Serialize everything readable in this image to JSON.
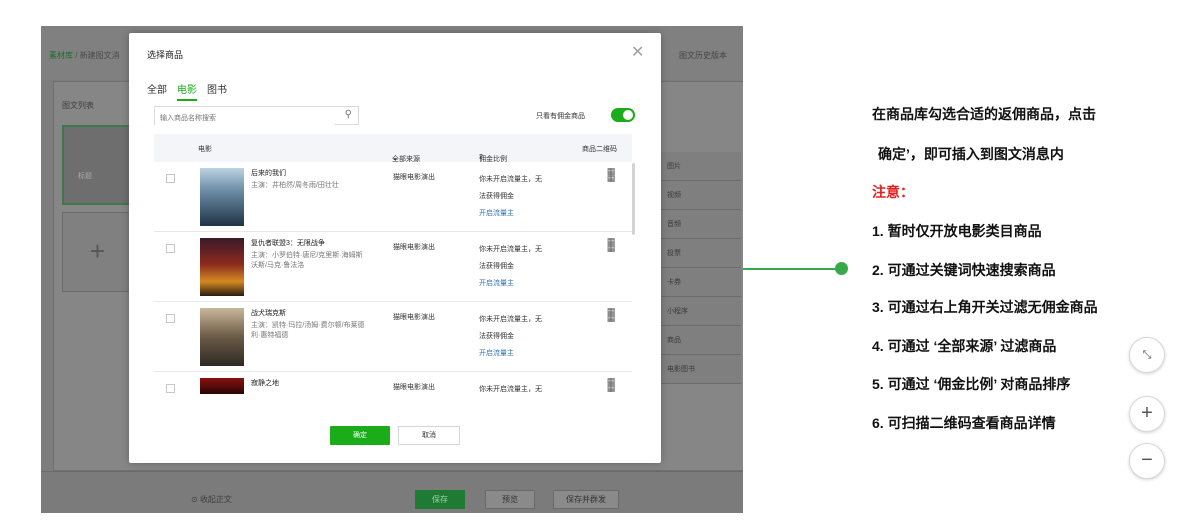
{
  "background": {
    "breadcrumb_root": "素材库",
    "breadcrumb_current": "新建图文消",
    "history_label": "图文历史版本",
    "panel_title": "图文列表",
    "thumb_label": "标题",
    "right_items": [
      "图片",
      "视频",
      "音频",
      "投票",
      "卡券",
      "小程序",
      "商品",
      "电影图书"
    ],
    "collapse_label": "收起正文",
    "save_label": "保存",
    "preview_label": "预览",
    "save_mass_label": "保存并群发"
  },
  "modal": {
    "title": "选择商品",
    "tabs": [
      "全部",
      "电影",
      "图书"
    ],
    "active_tab": "电影",
    "search_placeholder": "输入商品名称搜索",
    "only_commission_label": "只看有佣金商品",
    "columns": {
      "movie": "电影",
      "source": "全部来源",
      "commission": "佣金比例",
      "qrcode": "商品二维码"
    },
    "rows": [
      {
        "name": "后来的我们",
        "cast": "主演：井柏然/周冬雨/田壮壮",
        "source": "猫眼电影演出",
        "commission_line1": "你未开启流量主，无",
        "commission_line2": "法获得佣金",
        "commission_link": "开启流量主"
      },
      {
        "name": "复仇者联盟3：无限战争",
        "cast": "主演：小罗伯特·唐尼/克里斯·海姆斯沃斯/马克·鲁法洛",
        "source": "猫眼电影演出",
        "commission_line1": "你未开启流量主，无",
        "commission_line2": "法获得佣金",
        "commission_link": "开启流量主"
      },
      {
        "name": "战犬瑞克斯",
        "cast": "主演：凯特·玛拉/汤姆·费尔顿/布莱德利·惠特福德",
        "source": "猫眼电影演出",
        "commission_line1": "你未开启流量主，无",
        "commission_line2": "法获得佣金",
        "commission_link": "开启流量主"
      },
      {
        "name": "寂静之地",
        "cast": "",
        "source": "猫眼电影演出",
        "commission_line1": "你未开启流量主，无",
        "commission_line2": "",
        "commission_link": ""
      }
    ],
    "confirm_label": "确定",
    "cancel_label": "取消"
  },
  "notes": {
    "line1": "在商品库勾选合适的返佣商品，点击",
    "line2": "确定’，即可插入到图文消息内",
    "warning": "注意：",
    "items": [
      "1.  暂时仅开放电影类目商品",
      "2.  可通过关键词快速搜索商品",
      "3.  可通过右上角开关过滤无佣金商品",
      "4.  可通过 ‘全部来源’ 过滤商品",
      "5.  可通过 ‘佣金比例’ 对商品排序",
      "6.  可扫描二维码查看商品详情"
    ]
  },
  "colors": {
    "accent": "#1aad19",
    "link": "#2d73b9",
    "warning": "#e02020",
    "callout": "#38a84b"
  }
}
